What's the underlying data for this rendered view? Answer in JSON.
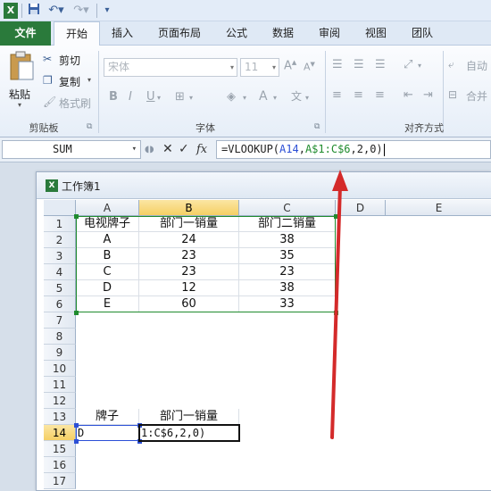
{
  "colors": {
    "file_tab": "#2a7a3b",
    "accent_blue": "#2b4fd6",
    "accent_green": "#1f8b2d",
    "arrow_red": "#d42a2a",
    "selected_header": "#f5cf64"
  },
  "qat": {
    "logo": "X",
    "icons": [
      "excel-logo-icon",
      "save-icon",
      "undo-icon",
      "redo-icon",
      "customize-icon"
    ]
  },
  "tabs": [
    "文件",
    "开始",
    "插入",
    "页面布局",
    "公式",
    "数据",
    "审阅",
    "视图",
    "团队"
  ],
  "ribbon": {
    "paste_label": "粘贴",
    "cut_label": "剪切",
    "copy_label": "复制",
    "format_painter_label": "格式刷",
    "clipboard_group": "剪贴板",
    "font_name": "宋体",
    "font_size": "11",
    "font_group": "字体",
    "align_group": "对齐方式",
    "wrap_label": "自动",
    "merge_label": "合并"
  },
  "formula_bar": {
    "name_box": "SUM",
    "fx": "fx",
    "formula_prefix": "=VLOOKUP(",
    "ref1": "A14",
    "comma": ",",
    "ref2": "A$1:C$6",
    "formula_suffix": ",2,0)"
  },
  "workbook": {
    "title": "工作簿1",
    "columns": [
      "A",
      "B",
      "C",
      "D",
      "E"
    ],
    "rows": [
      "1",
      "2",
      "3",
      "4",
      "5",
      "6",
      "7",
      "8",
      "9",
      "10",
      "11",
      "12",
      "13",
      "14",
      "15",
      "16",
      "17"
    ],
    "table_header": [
      "电视牌子",
      "部门一销量",
      "部门二销量"
    ],
    "table_rows": [
      [
        "A",
        "24",
        "38"
      ],
      [
        "B",
        "23",
        "35"
      ],
      [
        "C",
        "23",
        "23"
      ],
      [
        "D",
        "12",
        "38"
      ],
      [
        "E",
        "60",
        "33"
      ]
    ],
    "lookup_header": [
      "牌子",
      "部门一销量"
    ],
    "lookup_row": [
      "D",
      "1:C$6,2,0)"
    ]
  }
}
